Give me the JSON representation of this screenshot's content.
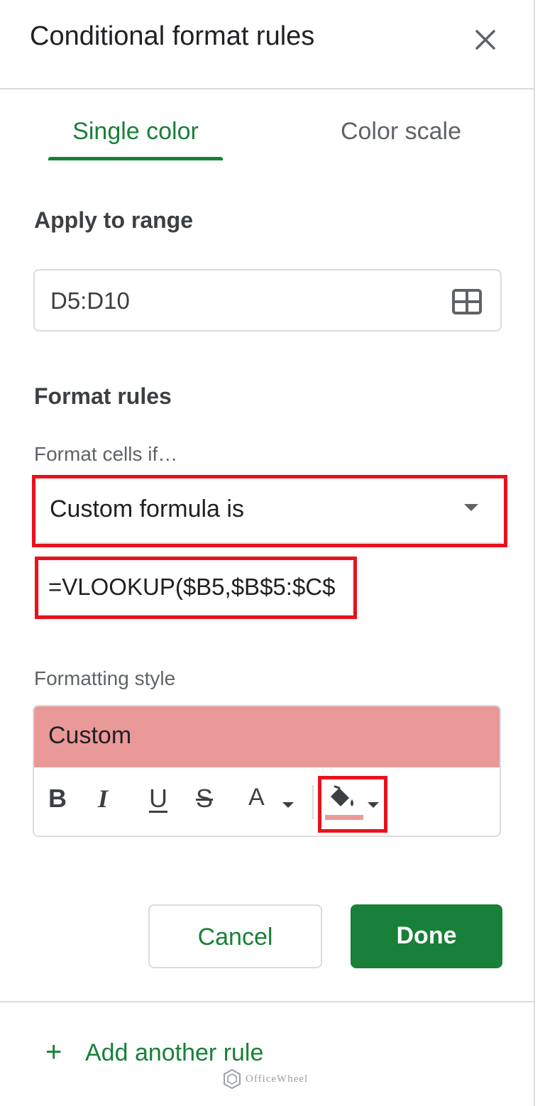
{
  "panel": {
    "title": "Conditional format rules",
    "close_icon": "close-icon"
  },
  "tabs": [
    {
      "label": "Single color",
      "active": true
    },
    {
      "label": "Color scale",
      "active": false
    }
  ],
  "apply_to_range": {
    "heading": "Apply to range",
    "value": "D5:D10",
    "icon": "grid-select-icon"
  },
  "format_rules": {
    "heading": "Format rules",
    "condition_label": "Format cells if…",
    "condition_value": "Custom formula is",
    "formula_value": "=VLOOKUP($B5,$B$5:$C$"
  },
  "formatting_style": {
    "label": "Formatting style",
    "preview_text": "Custom",
    "preview_color": "#ea9999",
    "fill_color": "#ea9999",
    "toolbar": {
      "bold": "B",
      "italic": "I",
      "underline": "U",
      "strikethrough": "S",
      "text_color": "A"
    }
  },
  "actions": {
    "cancel_label": "Cancel",
    "done_label": "Done"
  },
  "add_rule": {
    "plus": "+",
    "label": "Add another rule"
  },
  "watermark": {
    "text": "OfficeWheel"
  },
  "colors": {
    "accent_green": "#188038",
    "highlight_red": "#e8121c"
  }
}
